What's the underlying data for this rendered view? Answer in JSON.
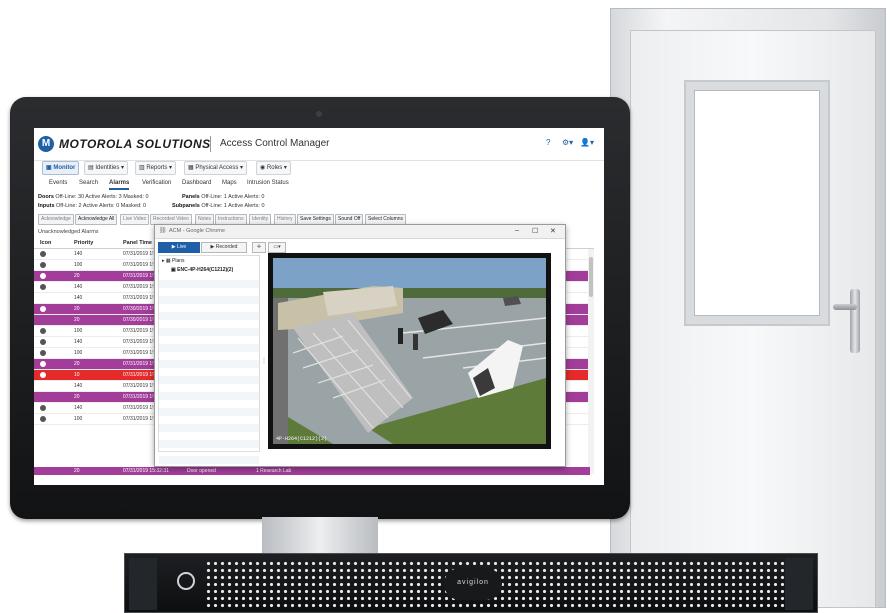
{
  "colors": {
    "accent": "#1f5fa8",
    "alarm_purple": "#a23d9a",
    "alarm_red": "#e52a2a",
    "monitor_bezel": "#1b1c1e"
  },
  "app": {
    "brand": "MOTOROLA SOLUTIONS",
    "title": "Access Control Manager",
    "help_icon": "?",
    "settings_icon": "⚙▾",
    "user_icon": "👤▾"
  },
  "topnav": [
    {
      "label": "Monitor",
      "icon": "monitor-icon",
      "active": true
    },
    {
      "label": "Identities ▾",
      "icon": "id-card-icon"
    },
    {
      "label": "Reports ▾",
      "icon": "bar-chart-icon"
    },
    {
      "label": "Physical Access ▾",
      "icon": "building-icon"
    },
    {
      "label": "Roles ▾",
      "icon": "users-icon"
    }
  ],
  "subnav": [
    "Events",
    "Search",
    "Alarms",
    "Verification",
    "Dashboard",
    "Maps",
    "Intrusion Status"
  ],
  "subnav_active": "Alarms",
  "status": {
    "doors": {
      "label": "Doors",
      "text": "Off-Line: 30  Active Alerts: 3  Masked: 0"
    },
    "inputs": {
      "label": "Inputs",
      "text": "Off-Line: 2   Active Alerts: 0  Masked: 0"
    },
    "panels": {
      "label": "Panels",
      "text": "Off-Line: 1  Active Alerts: 0"
    },
    "subpanels": {
      "label": "Subpanels",
      "text": "Off-Line: 1  Active Alerts: 0"
    }
  },
  "buttons": [
    {
      "label": "Acknowledge",
      "enabled": false
    },
    {
      "label": "Acknowledge All",
      "enabled": true
    },
    {
      "label": "Live Video",
      "enabled": false
    },
    {
      "label": "Recorded Video",
      "enabled": false
    },
    {
      "label": "Notes",
      "enabled": false
    },
    {
      "label": "Instructions",
      "enabled": false
    },
    {
      "label": "Identity",
      "enabled": false
    },
    {
      "label": "History",
      "enabled": false
    },
    {
      "label": "Save Settings",
      "enabled": true
    },
    {
      "label": "Sound Off",
      "enabled": true
    },
    {
      "label": "Select Columns",
      "enabled": true
    }
  ],
  "section_title": "Unacknowledged Alarms",
  "table": {
    "columns": [
      "Icon",
      "Priority",
      "Panel Time"
    ],
    "rows": [
      {
        "priority": "140",
        "time": "07/31/2019 1!",
        "style": "white",
        "icon": true
      },
      {
        "priority": "100",
        "time": "07/31/2019 1!",
        "style": "white",
        "icon": true
      },
      {
        "priority": "20",
        "time": "07/31/2019 1!",
        "style": "purple",
        "icon": true
      },
      {
        "priority": "140",
        "time": "07/31/2019 1!",
        "style": "white",
        "icon": true
      },
      {
        "priority": "140",
        "time": "07/31/2019 1!",
        "style": "white",
        "icon": false
      },
      {
        "priority": "20",
        "time": "07/30/2019 1!",
        "style": "purple",
        "icon": true
      },
      {
        "priority": "20",
        "time": "07/30/2019 1!",
        "style": "purple",
        "icon": false
      },
      {
        "priority": "100",
        "time": "07/31/2019 1!",
        "style": "white",
        "icon": true
      },
      {
        "priority": "140",
        "time": "07/31/2019 1!",
        "style": "white",
        "icon": true
      },
      {
        "priority": "100",
        "time": "07/31/2019 1!",
        "style": "white",
        "icon": true
      },
      {
        "priority": "20",
        "time": "07/31/2019 1!",
        "style": "purple",
        "icon": true
      },
      {
        "priority": "10",
        "time": "07/31/2019 1!",
        "style": "red",
        "icon": true
      },
      {
        "priority": "140",
        "time": "07/31/2019 1!",
        "style": "white",
        "icon": false
      },
      {
        "priority": "20",
        "time": "07/31/2019 1!",
        "style": "purple",
        "icon": false
      },
      {
        "priority": "140",
        "time": "07/31/2019 1!",
        "style": "white",
        "icon": true
      },
      {
        "priority": "100",
        "time": "07/31/2019 1!",
        "style": "white",
        "icon": true
      }
    ],
    "last_row": {
      "priority": "20",
      "time": "07/31/2019 15:32:31",
      "extra": "Door opened",
      "extra2": "1 Research Lab"
    }
  },
  "popup": {
    "title": "ACM - Google Chrome",
    "controls": [
      "–",
      "☐",
      "✕"
    ],
    "tab_live": "▶ Live",
    "tab_recorded": "▶ Recorded",
    "tree_root": "Plans",
    "tree_camera": "ENC-4P-H264(C1212)(2)",
    "camera_label": "4P-H264(C1212)(2)"
  },
  "server": {
    "vendor": "avigilon"
  }
}
